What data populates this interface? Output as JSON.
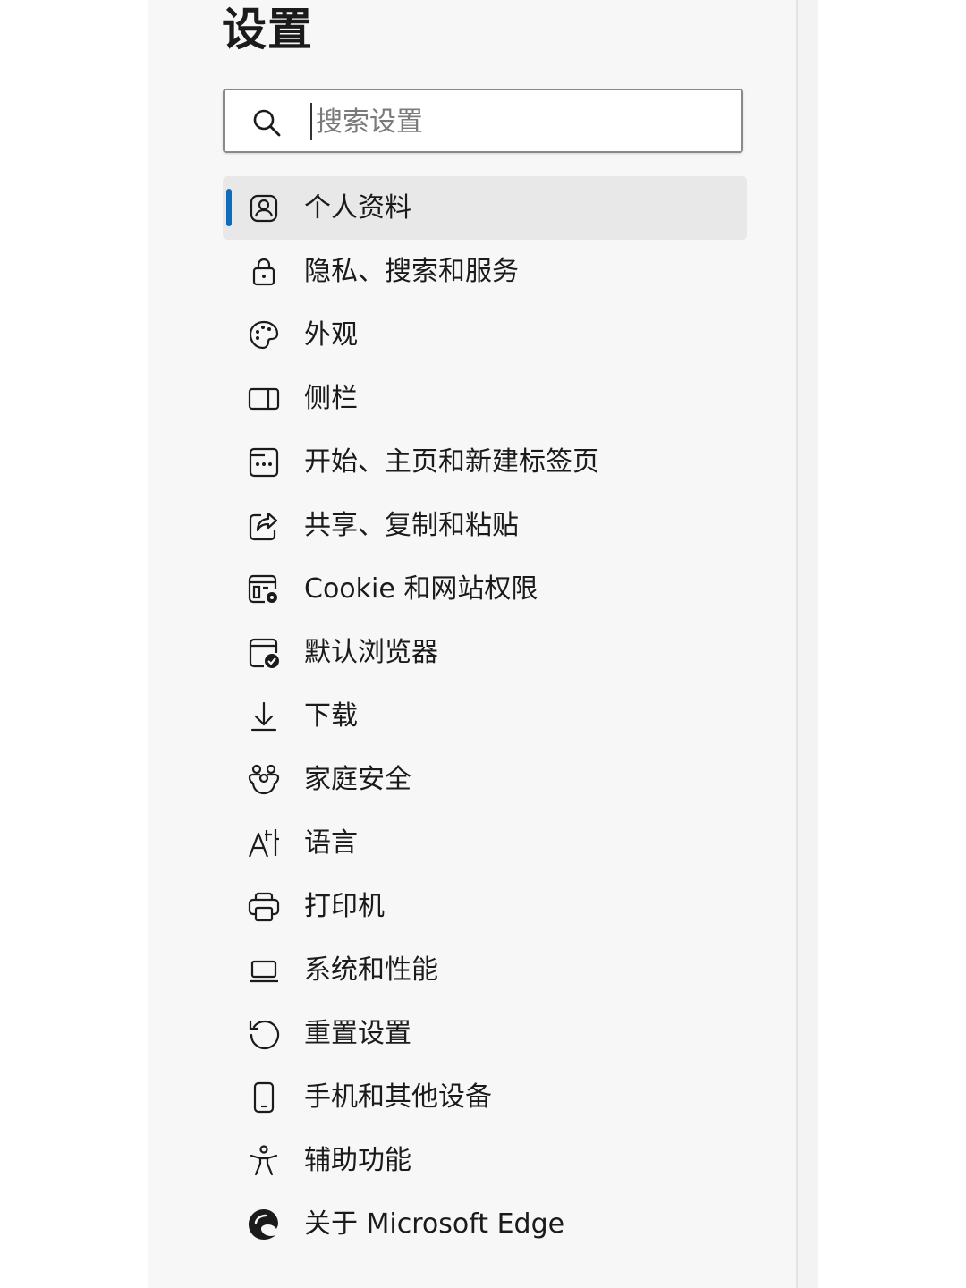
{
  "page": {
    "title": "设置"
  },
  "search": {
    "placeholder": "搜索设置",
    "icon": "search-icon"
  },
  "nav": {
    "active_index": 0,
    "accent_color": "#0f6cbd",
    "items": [
      {
        "label": "个人资料",
        "icon": "profile-icon"
      },
      {
        "label": "隐私、搜索和服务",
        "icon": "lock-icon"
      },
      {
        "label": "外观",
        "icon": "palette-icon"
      },
      {
        "label": "侧栏",
        "icon": "sidebar-icon"
      },
      {
        "label": "开始、主页和新建标签页",
        "icon": "home-tab-icon"
      },
      {
        "label": "共享、复制和粘贴",
        "icon": "share-icon"
      },
      {
        "label": "Cookie 和网站权限",
        "icon": "cookie-settings-icon"
      },
      {
        "label": "默认浏览器",
        "icon": "default-browser-icon"
      },
      {
        "label": "下载",
        "icon": "download-icon"
      },
      {
        "label": "家庭安全",
        "icon": "family-icon"
      },
      {
        "label": "语言",
        "icon": "language-icon"
      },
      {
        "label": "打印机",
        "icon": "printer-icon"
      },
      {
        "label": "系统和性能",
        "icon": "laptop-icon"
      },
      {
        "label": "重置设置",
        "icon": "reset-icon"
      },
      {
        "label": "手机和其他设备",
        "icon": "phone-icon"
      },
      {
        "label": "辅助功能",
        "icon": "accessibility-icon"
      },
      {
        "label": "关于 Microsoft Edge",
        "icon": "edge-logo-icon"
      }
    ]
  }
}
